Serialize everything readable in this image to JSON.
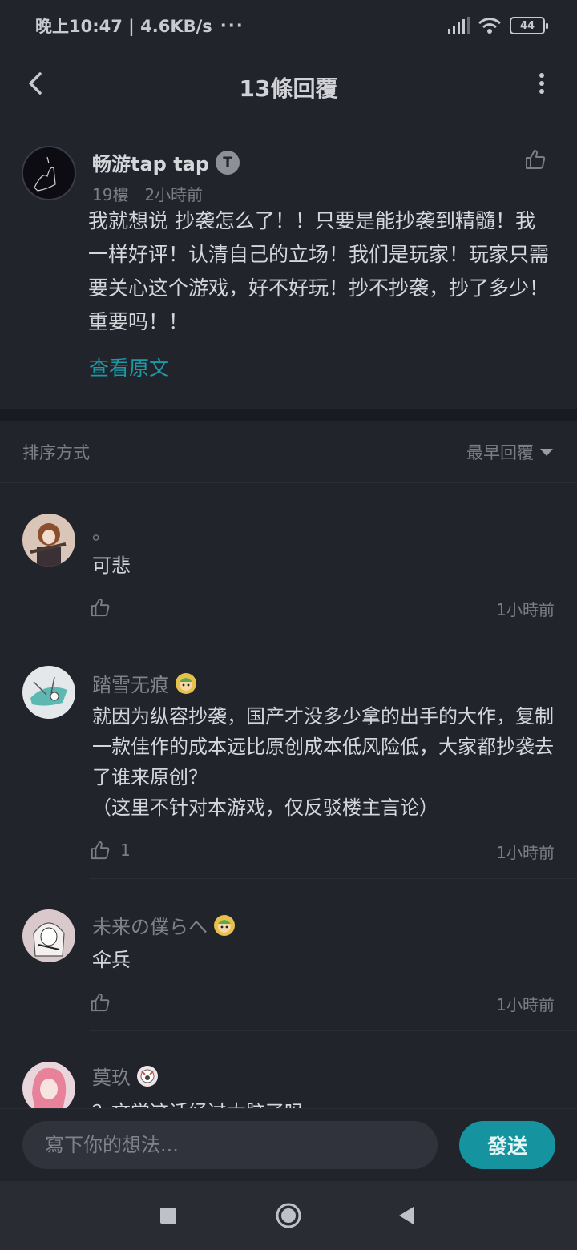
{
  "status_bar": {
    "time_speed": "晚上10:47 | 4.6KB/s",
    "dots": "···",
    "battery": "44"
  },
  "header": {
    "title": "13條回覆",
    "back_icon": "chevron-left-icon",
    "more_icon": "more-vertical-icon"
  },
  "main_post": {
    "author": "畅游tap tap",
    "badge": "T",
    "floor": "19樓",
    "time": "2小時前",
    "text": "我就想说  抄袭怎么了！！只要是能抄袭到精髓！我一样好评！认清自己的立场！我们是玩家！玩家只需要关心这个游戏，好不好玩！抄不抄袭，抄了多少！重要吗！！",
    "view_original": "查看原文"
  },
  "sort": {
    "label": "排序方式",
    "value": "最早回覆"
  },
  "replies": [
    {
      "name": "。",
      "text": "可悲",
      "likes": "",
      "time": "1小時前"
    },
    {
      "name": "踏雪无痕",
      "text": "就因为纵容抄袭，国产才没多少拿的出手的大作，复制一款佳作的成本远比原创成本低风险低，大家都抄袭去了谁来原创？\n（这里不针对本游戏，仅反驳楼主言论）",
      "likes": "1",
      "time": "1小時前"
    },
    {
      "name": "未来の僕らへ",
      "text": "伞兵",
      "likes": "",
      "time": "1小時前"
    },
    {
      "name": "莫玖",
      "text": "？文学这话经过大脑了吗",
      "likes": "",
      "time": ""
    }
  ],
  "composer": {
    "placeholder": "寫下你的想法...",
    "send_label": "發送"
  },
  "colors": {
    "background": "#22242c",
    "accent": "#15949f",
    "link": "#1b9aa6"
  }
}
